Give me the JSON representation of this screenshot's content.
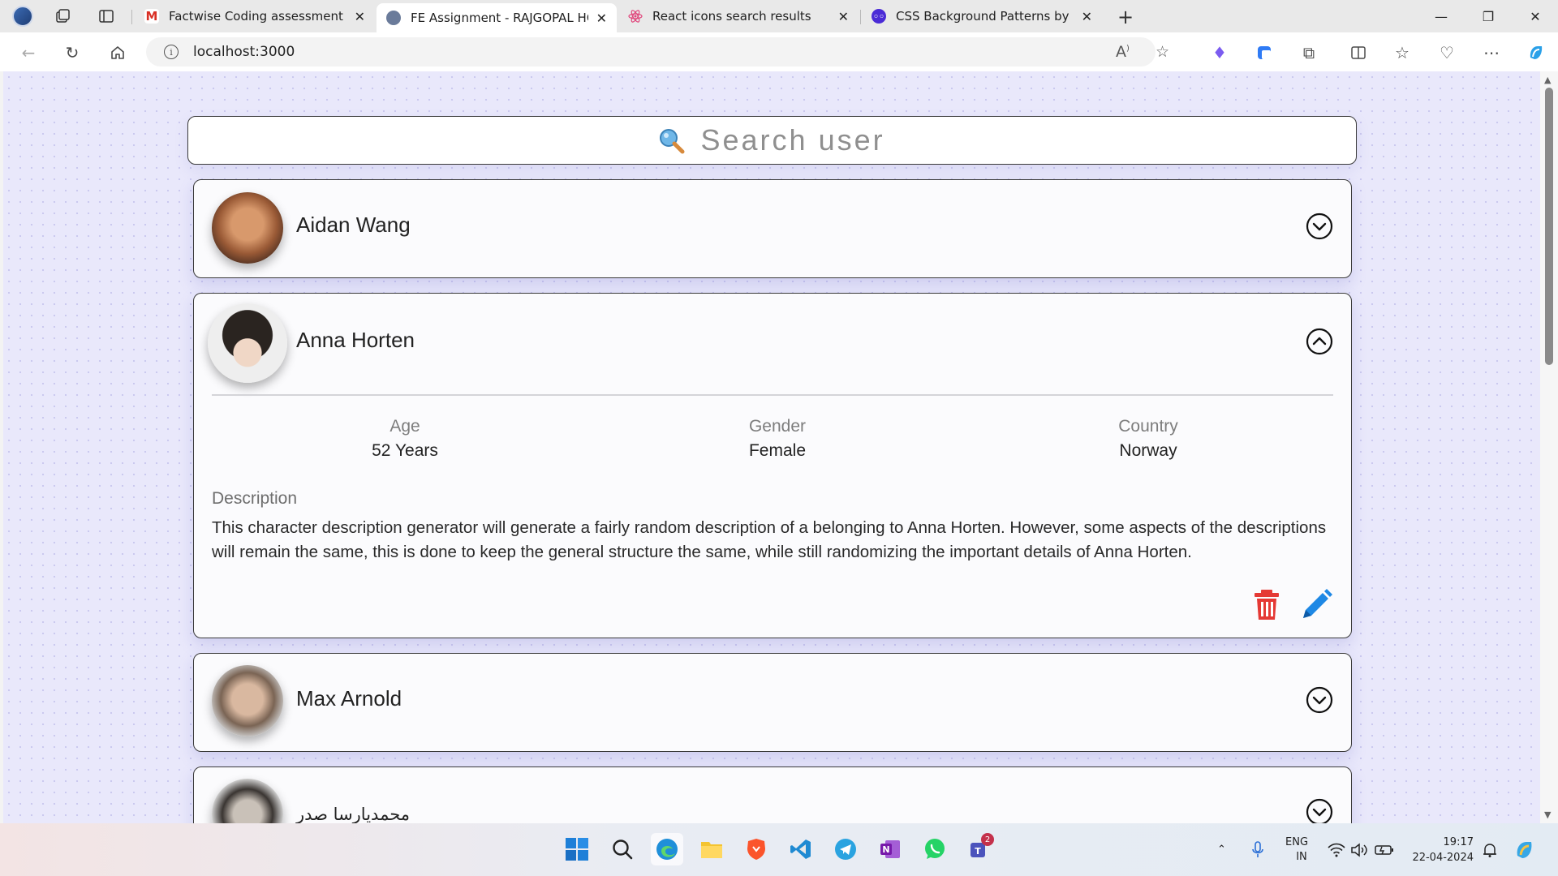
{
  "browser": {
    "tabs": [
      {
        "title": "Factwise Coding assessment - Ba",
        "favicon": "gmail-icon",
        "active": false
      },
      {
        "title": "FE Assignment - RAJGOPAL HOTA",
        "favicon": "avatar-icon",
        "active": true
      },
      {
        "title": "React icons search results",
        "favicon": "react-icon",
        "active": false
      },
      {
        "title": "CSS Background Patterns by Mag",
        "favicon": "pattern-icon",
        "active": false
      }
    ],
    "url": "localhost:3000"
  },
  "search": {
    "placeholder": "Search user"
  },
  "users": [
    {
      "name": "Aidan Wang",
      "expanded": false
    },
    {
      "name": "Anna Horten",
      "expanded": true,
      "age_label": "Age",
      "age": "52 Years",
      "gender_label": "Gender",
      "gender": "Female",
      "country_label": "Country",
      "country": "Norway",
      "description_label": "Description",
      "description": "This character description generator will generate a fairly random description of a belonging to Anna Horten. However, some aspects of the descriptions will remain the same, this is done to keep the general structure the same, while still randomizing the important details of Anna Horten."
    },
    {
      "name": "Max Arnold",
      "expanded": false
    },
    {
      "name": "محمدیارسا صدر",
      "expanded": false
    }
  ],
  "colors": {
    "delete": "#e53935",
    "edit": "#1e88e5",
    "border": "#3a3a3a",
    "background": "#e9e8fb"
  },
  "taskbar": {
    "language": "ENG",
    "region": "IN",
    "time": "19:17",
    "date": "22-04-2024",
    "teams_badge": "2"
  }
}
